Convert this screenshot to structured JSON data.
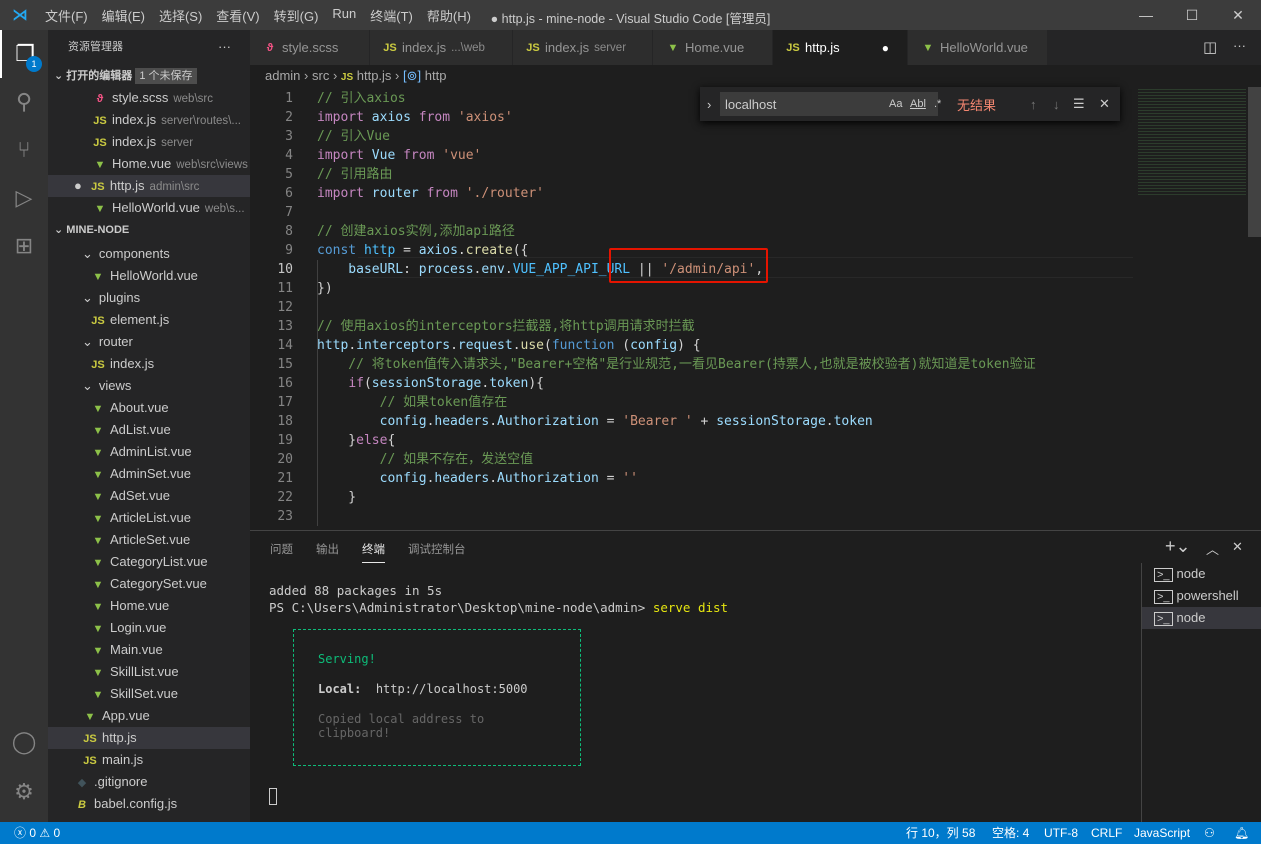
{
  "titlebar": {
    "menus": [
      "文件(F)",
      "编辑(E)",
      "选择(S)",
      "查看(V)",
      "转到(G)",
      "Run",
      "终端(T)",
      "帮助(H)"
    ],
    "title": "● http.js - mine-node - Visual Studio Code [管理员]"
  },
  "activity": {
    "explorer_badge": "1"
  },
  "sidebar": {
    "title": "资源管理器",
    "more": "···",
    "open_editors_label": "打开的编辑器",
    "unsaved_badge": "1 个未保存",
    "open_editors": [
      {
        "name": "style.scss",
        "desc": "web\\src",
        "type": "scss"
      },
      {
        "name": "index.js",
        "desc": "server\\routes\\...",
        "type": "js"
      },
      {
        "name": "index.js",
        "desc": "server",
        "type": "js"
      },
      {
        "name": "Home.vue",
        "desc": "web\\src\\views",
        "type": "vue"
      },
      {
        "name": "http.js",
        "desc": "admin\\src",
        "type": "js",
        "selected": true,
        "modified": true
      },
      {
        "name": "HelloWorld.vue",
        "desc": "web\\s...",
        "type": "vue"
      }
    ],
    "project_label": "MINE-NODE",
    "tree": [
      {
        "name": "components",
        "folder": true,
        "level": 1
      },
      {
        "name": "HelloWorld.vue",
        "type": "vue",
        "level": 2
      },
      {
        "name": "plugins",
        "folder": true,
        "level": 1
      },
      {
        "name": "element.js",
        "type": "js",
        "level": 2
      },
      {
        "name": "router",
        "folder": true,
        "level": 1
      },
      {
        "name": "index.js",
        "type": "js",
        "level": 2
      },
      {
        "name": "views",
        "folder": true,
        "level": 1
      },
      {
        "name": "About.vue",
        "type": "vue",
        "level": 2
      },
      {
        "name": "AdList.vue",
        "type": "vue",
        "level": 2
      },
      {
        "name": "AdminList.vue",
        "type": "vue",
        "level": 2
      },
      {
        "name": "AdminSet.vue",
        "type": "vue",
        "level": 2
      },
      {
        "name": "AdSet.vue",
        "type": "vue",
        "level": 2
      },
      {
        "name": "ArticleList.vue",
        "type": "vue",
        "level": 2
      },
      {
        "name": "ArticleSet.vue",
        "type": "vue",
        "level": 2
      },
      {
        "name": "CategoryList.vue",
        "type": "vue",
        "level": 2
      },
      {
        "name": "CategorySet.vue",
        "type": "vue",
        "level": 2
      },
      {
        "name": "Home.vue",
        "type": "vue",
        "level": 2
      },
      {
        "name": "Login.vue",
        "type": "vue",
        "level": 2
      },
      {
        "name": "Main.vue",
        "type": "vue",
        "level": 2
      },
      {
        "name": "SkillList.vue",
        "type": "vue",
        "level": 2
      },
      {
        "name": "SkillSet.vue",
        "type": "vue",
        "level": 2
      },
      {
        "name": "App.vue",
        "type": "vue",
        "level": 1
      },
      {
        "name": "http.js",
        "type": "js",
        "level": 1,
        "selected": true
      },
      {
        "name": "main.js",
        "type": "js",
        "level": 1
      },
      {
        "name": ".gitignore",
        "type": "git",
        "level": 0
      },
      {
        "name": "babel.config.js",
        "type": "babel",
        "level": 0
      }
    ]
  },
  "tabs": [
    {
      "name": "style.scss",
      "desc": "",
      "type": "scss"
    },
    {
      "name": "index.js",
      "desc": "...\\web",
      "type": "js"
    },
    {
      "name": "index.js",
      "desc": "server",
      "type": "js"
    },
    {
      "name": "Home.vue",
      "desc": "",
      "type": "vue"
    },
    {
      "name": "http.js",
      "desc": "",
      "type": "js",
      "active": true,
      "modified": true
    },
    {
      "name": "HelloWorld.vue",
      "desc": "",
      "type": "vue"
    }
  ],
  "breadcrumb": [
    "admin",
    "src",
    "http.js",
    "http"
  ],
  "find": {
    "value": "localhost",
    "result": "无结果",
    "options": [
      "Aa",
      "Abl",
      ".*"
    ]
  },
  "editor": {
    "current_line": 10,
    "highlight_color": "#e51400",
    "lines": [
      [
        [
          "// 引入axios",
          "c"
        ]
      ],
      [
        [
          "import ",
          "i"
        ],
        [
          "axios ",
          "v"
        ],
        [
          "from ",
          "i"
        ],
        [
          "'axios'",
          "s"
        ]
      ],
      [
        [
          "// 引入Vue",
          "c"
        ]
      ],
      [
        [
          "import ",
          "i"
        ],
        [
          "Vue ",
          "v"
        ],
        [
          "from ",
          "i"
        ],
        [
          "'vue'",
          "s"
        ]
      ],
      [
        [
          "// 引用路由",
          "c"
        ]
      ],
      [
        [
          "import ",
          "i"
        ],
        [
          "router ",
          "v"
        ],
        [
          "from ",
          "i"
        ],
        [
          "'./router'",
          "s"
        ]
      ],
      [],
      [
        [
          "// 创建axios实例,添加api路径",
          "c"
        ]
      ],
      [
        [
          "const ",
          "k"
        ],
        [
          "http ",
          "n"
        ],
        [
          "= ",
          "p"
        ],
        [
          "axios",
          "v"
        ],
        [
          ".",
          "p"
        ],
        [
          "create",
          "f"
        ],
        [
          "({",
          "p"
        ]
      ],
      [
        [
          "    baseURL",
          "v"
        ],
        [
          ": ",
          "p"
        ],
        [
          "process",
          "v"
        ],
        [
          ".",
          "p"
        ],
        [
          "env",
          "v"
        ],
        [
          ".",
          "p"
        ],
        [
          "VUE_APP_API_URL ",
          "n"
        ],
        [
          "|| ",
          "p"
        ],
        [
          "'/admin/api'",
          "s"
        ],
        [
          ",",
          "p"
        ]
      ],
      [
        [
          "})",
          "p"
        ]
      ],
      [],
      [
        [
          "// 使用axios的interceptors拦截器,将http调用请求时拦截",
          "c"
        ]
      ],
      [
        [
          "http",
          "v"
        ],
        [
          ".",
          "p"
        ],
        [
          "interceptors",
          "v"
        ],
        [
          ".",
          "p"
        ],
        [
          "request",
          "v"
        ],
        [
          ".",
          "p"
        ],
        [
          "use",
          "f"
        ],
        [
          "(",
          "p"
        ],
        [
          "function ",
          "k"
        ],
        [
          "(",
          "p"
        ],
        [
          "config",
          "v"
        ],
        [
          ") {",
          "p"
        ]
      ],
      [
        [
          "    // 将token值传入请求头,\"Bearer+空格\"是行业规范,一看见Bearer(持票人,也就是被校验者)就知道是token验证",
          "c"
        ]
      ],
      [
        [
          "    ",
          "p"
        ],
        [
          "if",
          "i"
        ],
        [
          "(",
          "p"
        ],
        [
          "sessionStorage",
          "v"
        ],
        [
          ".",
          "p"
        ],
        [
          "token",
          "v"
        ],
        [
          "){",
          "p"
        ]
      ],
      [
        [
          "        // 如果token值存在",
          "c"
        ]
      ],
      [
        [
          "        config",
          "v"
        ],
        [
          ".",
          "p"
        ],
        [
          "headers",
          "v"
        ],
        [
          ".",
          "p"
        ],
        [
          "Authorization ",
          "v"
        ],
        [
          "= ",
          "p"
        ],
        [
          "'Bearer ' ",
          "s"
        ],
        [
          "+ ",
          "p"
        ],
        [
          "sessionStorage",
          "v"
        ],
        [
          ".",
          "p"
        ],
        [
          "token",
          "v"
        ]
      ],
      [
        [
          "    }",
          "p"
        ],
        [
          "else",
          "i"
        ],
        [
          "{",
          "p"
        ]
      ],
      [
        [
          "        // 如果不存在，发送空值",
          "c"
        ]
      ],
      [
        [
          "        config",
          "v"
        ],
        [
          ".",
          "p"
        ],
        [
          "headers",
          "v"
        ],
        [
          ".",
          "p"
        ],
        [
          "Authorization ",
          "v"
        ],
        [
          "= ",
          "p"
        ],
        [
          "''",
          "s"
        ]
      ],
      [
        [
          "    }",
          "p"
        ]
      ],
      []
    ]
  },
  "panel": {
    "tabs": [
      "问题",
      "输出",
      "终端",
      "调试控制台"
    ],
    "active_tab": "终端",
    "terminal": {
      "line1": "added 88 packages in 5s",
      "prompt": "PS C:\\Users\\Administrator\\Desktop\\mine-node\\admin> ",
      "command": "serve dist",
      "serving": "Serving!",
      "local_label": "Local:",
      "local_url": "http://localhost:5000",
      "copied": "Copied local address to clipboard!"
    },
    "instances": [
      "node",
      "powershell",
      "node"
    ],
    "selected_instance": 2
  },
  "status": {
    "errors": "0",
    "warnings": "0",
    "position": "行 10，列 58",
    "spaces": "空格: 4",
    "encoding": "UTF-8",
    "eol": "CRLF",
    "language": "JavaScript"
  }
}
